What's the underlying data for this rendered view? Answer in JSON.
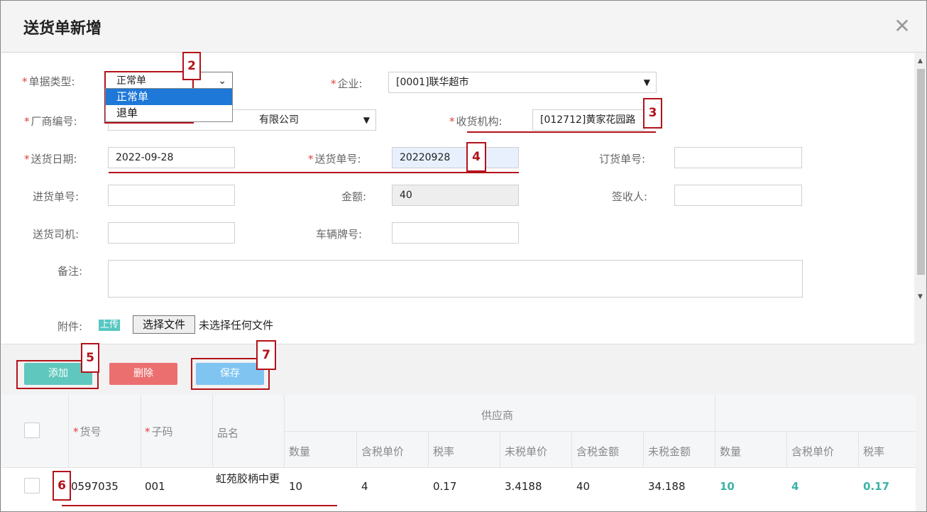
{
  "dialog": {
    "title": "送货单新增"
  },
  "form": {
    "doc_type": {
      "label": "单据类型:",
      "value": "正常单",
      "options": [
        "正常单",
        "退单"
      ]
    },
    "enterprise": {
      "label": "企业:",
      "value": "[0001]联华超市"
    },
    "vendor": {
      "label": "厂商编号:",
      "value": "[...]...有限公司",
      "visible_suffix": "有限公司"
    },
    "receiver": {
      "label": "收货机构:",
      "value": "[012712]黄家花园路"
    },
    "delivery_date": {
      "label": "送货日期:",
      "value": "2022-09-28"
    },
    "delivery_no": {
      "label": "送货单号:",
      "value": "20220928"
    },
    "order_no": {
      "label": "订货单号:",
      "value": ""
    },
    "purchase_no": {
      "label": "进货单号:",
      "value": ""
    },
    "amount": {
      "label": "金额:",
      "value": "40"
    },
    "signer": {
      "label": "签收人:",
      "value": ""
    },
    "driver": {
      "label": "送货司机:",
      "value": ""
    },
    "plate": {
      "label": "车辆牌号:",
      "value": ""
    },
    "remark": {
      "label": "备注:",
      "value": ""
    },
    "attachment": {
      "label": "附件:",
      "upload": "上传",
      "choose": "选择文件",
      "none": "未选择任何文件"
    }
  },
  "toolbar": {
    "add": "添加",
    "delete": "删除",
    "save": "保存"
  },
  "table": {
    "group_header": "供应商",
    "columns": [
      "货号",
      "子码",
      "品名"
    ],
    "sub_columns": [
      "数量",
      "含税单价",
      "税率",
      "未税单价",
      "含税金额",
      "未税金额",
      "数量",
      "含税单价",
      "税率"
    ],
    "rows": [
      {
        "code": "0597035",
        "sub": "001",
        "name": "虹苑胶柄中更",
        "qty": "10",
        "price": "4",
        "rate": "0.17",
        "net_price": "3.4188",
        "amount": "40",
        "net_amount": "34.188",
        "qty2": "10",
        "price2": "4",
        "rate2": "0.17"
      }
    ]
  },
  "annotations": [
    "2",
    "3",
    "4",
    "5",
    "6",
    "7"
  ],
  "colors": {
    "accent_red": "#b3121a",
    "teal": "#5fc7bd",
    "danger": "#ec6f6f",
    "save_blue": "#80c4f2"
  }
}
